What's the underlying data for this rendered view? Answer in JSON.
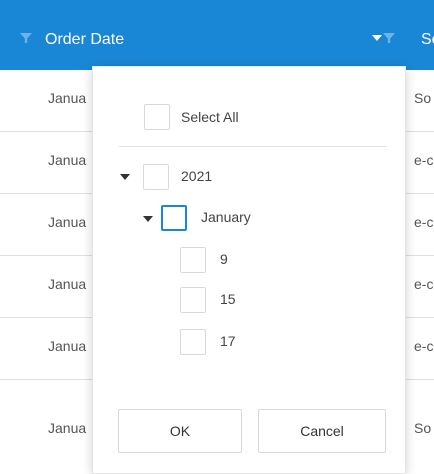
{
  "header": {
    "order_date_title": "Order Date",
    "next_column_title": "Sc",
    "accent_color": "#1a87d6",
    "icons": [
      "filter-icon",
      "sort-caret-icon",
      "filter-icon"
    ]
  },
  "rows": [
    {
      "date": "Janua",
      "next": "So"
    },
    {
      "date": "Janua",
      "next": "e-c"
    },
    {
      "date": "Janua",
      "next": "e-c"
    },
    {
      "date": "Janua",
      "next": "e-c"
    },
    {
      "date": "Janua",
      "next": "e-c"
    },
    {
      "date": "Janua",
      "next": "So"
    }
  ],
  "filter_popup": {
    "select_all_label": "Select All",
    "tree": {
      "year_label": "2021",
      "month_label": "January",
      "days": [
        "9",
        "15",
        "17"
      ]
    },
    "ok_label": "OK",
    "cancel_label": "Cancel"
  }
}
